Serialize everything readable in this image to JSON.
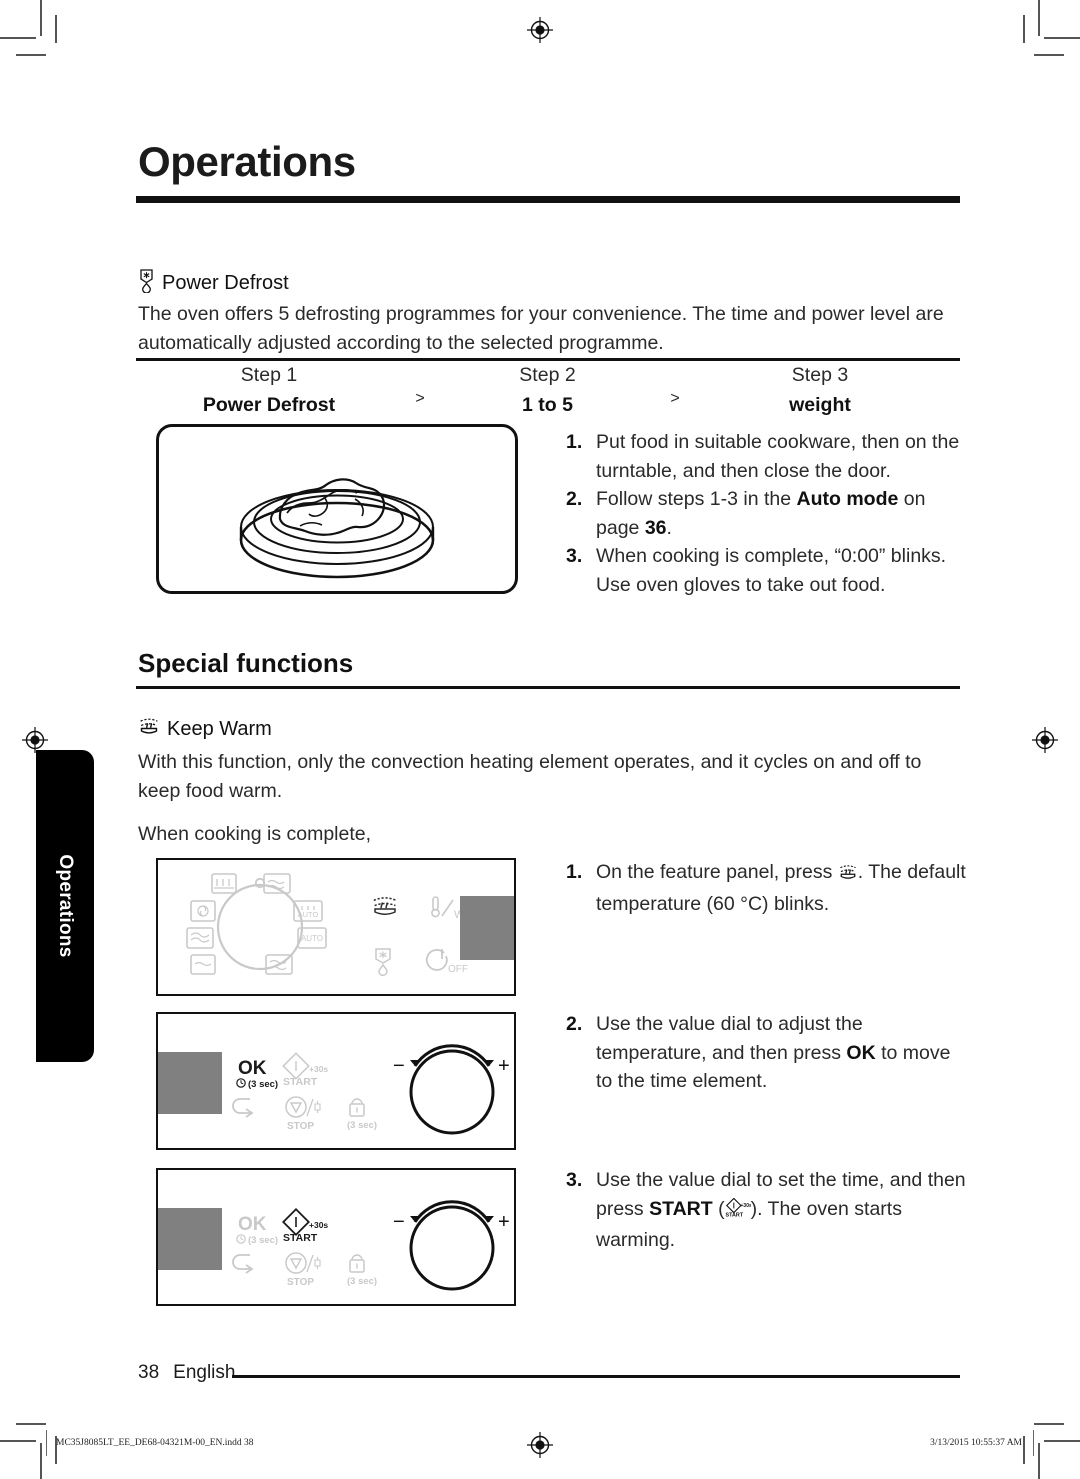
{
  "document": {
    "chapter_title": "Operations",
    "side_tab_label": "Operations"
  },
  "power_defrost": {
    "heading": "Power Defrost",
    "heading_icon": "defrost-icon",
    "intro": "The oven offers 5 defrosting programmes for your convenience. The time and power level are automatically adjusted according to the selected programme.",
    "steps": [
      {
        "label": "Step 1",
        "value": "Power Defrost"
      },
      {
        "label": "Step 2",
        "value": "1 to 5"
      },
      {
        "label": "Step 3",
        "value": "weight"
      }
    ],
    "arrow": ">",
    "illustration_name": "food-on-turntable-illustration",
    "instructions": [
      {
        "num": "1.",
        "text": "Put food in suitable cookware, then on the turntable, and then close the door."
      },
      {
        "num": "2.",
        "text": "Follow steps 1-3 in the <b>Auto mode</b> on page <b>36</b>."
      },
      {
        "num": "3.",
        "text": "When cooking is complete, “0:00” blinks. Use oven gloves to take out food."
      }
    ]
  },
  "special_functions": {
    "heading": "Special functions",
    "keep_warm": {
      "heading": "Keep Warm",
      "heading_icon": "keep-warm-icon",
      "intro": "With this function, only the convection heating element operates, and it cycles on and off to keep food warm.",
      "cue": "When cooking is complete,",
      "instructions": [
        {
          "num": "1.",
          "text_before": "On the feature panel, press ",
          "icon": "keep-warm-icon",
          "text_after": ". The default temperature (60 °C) blinks."
        },
        {
          "num": "2.",
          "text": "Use the value dial to adjust the temperature, and then press <b>OK</b> to move to the time element."
        },
        {
          "num": "3.",
          "text_before": "Use the value dial to set the time, and then press <b>START</b> (",
          "icon": "start-button-icon",
          "text_after": "). The oven starts warming."
        }
      ]
    }
  },
  "control_panels": {
    "mode_panel": {
      "name": "mode-dial-panel",
      "dial_label": "mode-dial",
      "feature_icons": [
        {
          "name": "keep-warm-icon",
          "label": "",
          "active": true
        },
        {
          "name": "temperature-watt-icon",
          "label": "W",
          "active": false
        },
        {
          "name": "defrost-icon",
          "label": "",
          "active": false
        },
        {
          "name": "power-off-icon",
          "label": "OFF",
          "active": false
        }
      ],
      "mode_icons": [
        {
          "name": "grill-icon",
          "label": ""
        },
        {
          "name": "convection-fan-icon",
          "label": ""
        },
        {
          "name": "microwave-icon",
          "label": ""
        },
        {
          "name": "slim-fry-icon",
          "label": ""
        },
        {
          "name": "steam-icon",
          "label": ""
        },
        {
          "name": "auto-cook-icon",
          "label": "AUTO"
        },
        {
          "name": "auto-icon",
          "label": "AUTO"
        },
        {
          "name": "bottom-heat-icon",
          "label": ""
        }
      ]
    },
    "control_panel_ok": {
      "name": "control-panel-ok-highlighted",
      "buttons": [
        {
          "name": "ok-button",
          "label": "OK",
          "sub": "(3 sec)",
          "active": true
        },
        {
          "name": "start-button",
          "label": "START",
          "sub": "+30s",
          "active": false
        },
        {
          "name": "back-button",
          "label": "",
          "sub": "",
          "active": false
        },
        {
          "name": "stop-button",
          "label": "STOP",
          "sub": "",
          "active": false
        },
        {
          "name": "child-lock-button",
          "label": "",
          "sub": "(3 sec)",
          "active": false
        }
      ],
      "dial": {
        "name": "value-dial",
        "minus": "−",
        "plus": "+"
      }
    },
    "control_panel_start": {
      "name": "control-panel-start-highlighted",
      "buttons": [
        {
          "name": "ok-button",
          "label": "OK",
          "sub": "(3 sec)",
          "active": false
        },
        {
          "name": "start-button",
          "label": "START",
          "sub": "+30s",
          "active": true
        },
        {
          "name": "back-button",
          "label": "",
          "sub": "",
          "active": false
        },
        {
          "name": "stop-button",
          "label": "STOP",
          "sub": "",
          "active": false
        },
        {
          "name": "child-lock-button",
          "label": "",
          "sub": "(3 sec)",
          "active": false
        }
      ],
      "dial": {
        "name": "value-dial",
        "minus": "−",
        "plus": "+"
      }
    }
  },
  "footer": {
    "page_number": "38",
    "language": "English",
    "print_file": "MC35J8085LT_EE_DE68-04321M-00_EN.indd   38",
    "print_timestamp": "3/13/2015   10:55:37 AM"
  },
  "colors": {
    "ink": "#1b1b1b",
    "body_text": "#2a2a2a",
    "tab_bg": "#000000",
    "panel_inactive": "#c9c9c9",
    "display_gray": "#808080"
  }
}
